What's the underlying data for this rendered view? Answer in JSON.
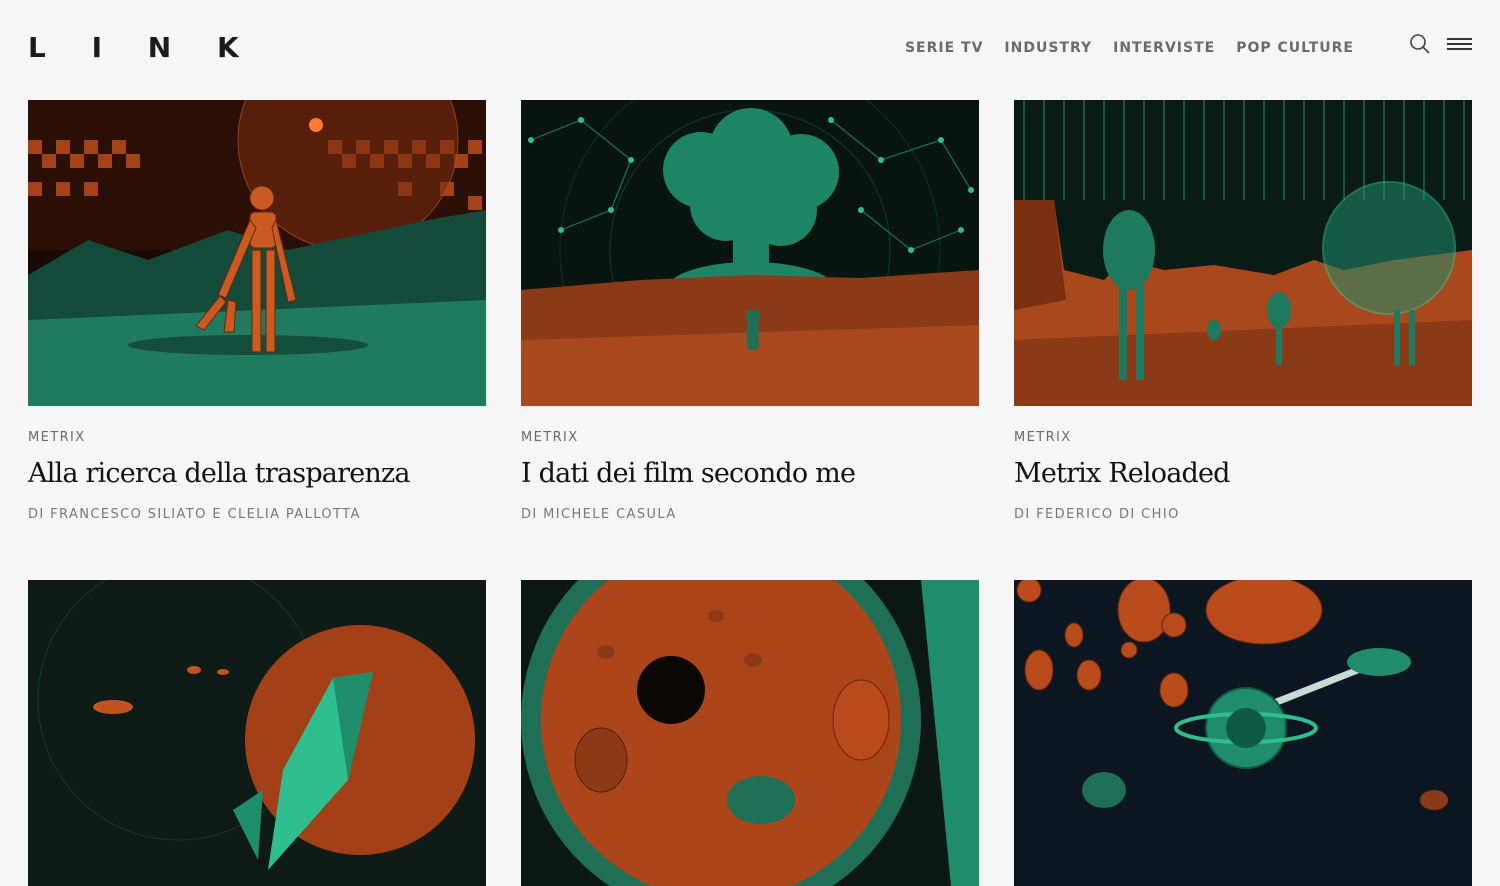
{
  "site": {
    "logo": "L I N K"
  },
  "nav": {
    "items": [
      {
        "label": "SERIE TV"
      },
      {
        "label": "INDUSTRY"
      },
      {
        "label": "INTERVISTE"
      },
      {
        "label": "POP CULTURE"
      }
    ],
    "search_icon": "search-icon",
    "menu_icon": "hamburger-menu-icon"
  },
  "colors": {
    "background": "#f6f6f6",
    "accent_orange": "#c2521f",
    "accent_teal": "#1f8c6c",
    "dark": "#0c1512"
  },
  "articles": [
    {
      "category": "METRIX",
      "title": "Alla ricerca della trasparenza",
      "author": "DI FRANCESCO SILIATO E CLELIA PALLOTTA"
    },
    {
      "category": "METRIX",
      "title": "I dati dei film secondo me",
      "author": "DI MICHELE CASULA"
    },
    {
      "category": "METRIX",
      "title": "Metrix Reloaded",
      "author": "DI FEDERICO DI CHIO"
    },
    {
      "category": "",
      "title": "",
      "author": ""
    },
    {
      "category": "",
      "title": "",
      "author": ""
    },
    {
      "category": "",
      "title": "",
      "author": ""
    }
  ]
}
